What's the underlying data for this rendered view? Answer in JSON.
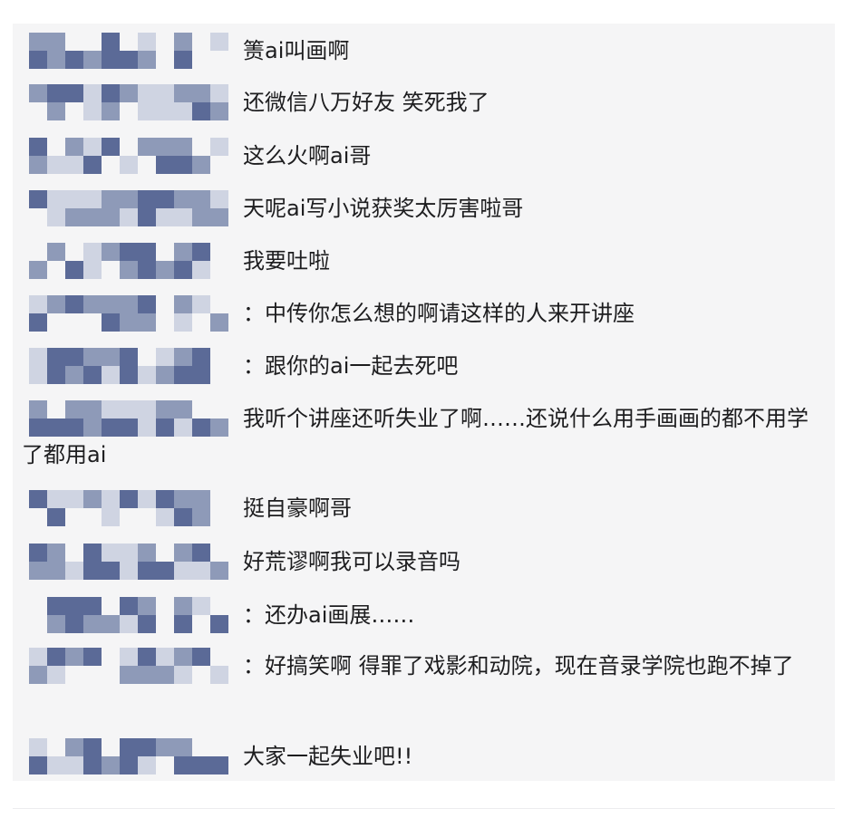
{
  "comments": [
    {
      "text": "箦ai叫画啊"
    },
    {
      "text": "还微信八万好友 笑死我了"
    },
    {
      "text": "这么火啊ai哥"
    },
    {
      "text": "天呢ai写小说获奖太厉害啦哥"
    },
    {
      "text": "我要吐啦"
    },
    {
      "text": "：中传你怎么想的啊请这样的人来开讲座"
    },
    {
      "text": "：跟你的ai一起去死吧"
    },
    {
      "text": "我听个讲座还听失业了啊……还说什么用手画画的都不用学了都用ai"
    },
    {
      "text": "挺自豪啊哥"
    },
    {
      "text": "好荒谬啊我可以录音吗"
    },
    {
      "text": "：还办ai画展……"
    },
    {
      "text": "：好搞笑啊 得罪了戏影和动院，现在音录学院也跑不掉了"
    },
    {
      "text": "大家一起失业吧!!"
    }
  ],
  "colors": {
    "panel": "#f5f5f6",
    "text": "#1d1d1f",
    "mosaic_dark": "#5b6a97",
    "mosaic_mid": "#8e9ab8",
    "mosaic_light": "#cfd4e2"
  }
}
